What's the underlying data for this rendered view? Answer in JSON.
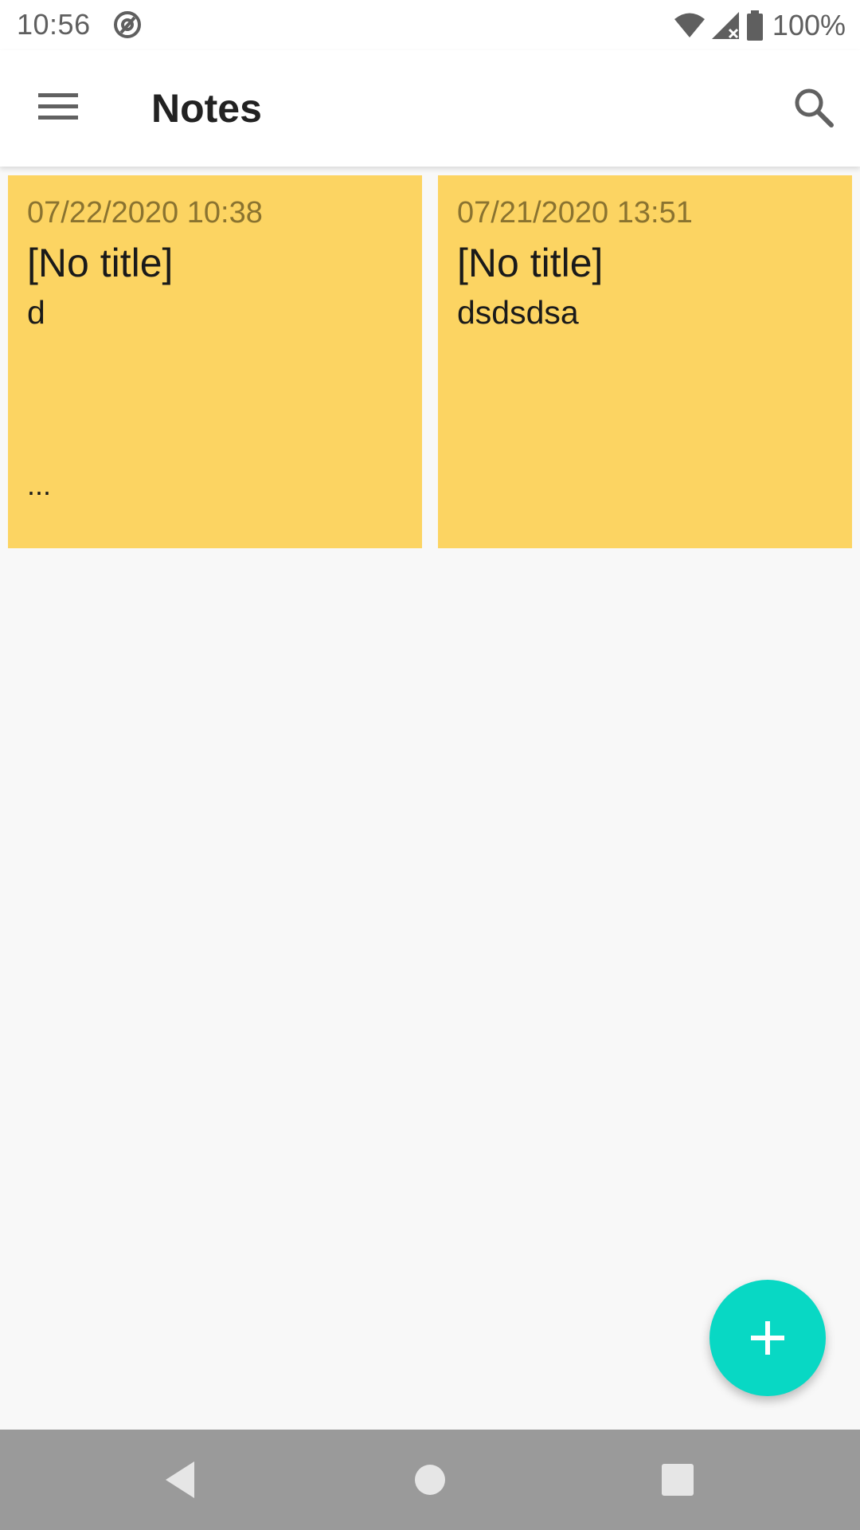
{
  "status_bar": {
    "time": "10:56",
    "battery_percent": "100%"
  },
  "app_bar": {
    "title": "Notes",
    "icons": [
      "menu-icon",
      "search-icon"
    ]
  },
  "notes": [
    {
      "date": "07/22/2020 10:38",
      "title": "[No title]",
      "body": "d",
      "more": "..."
    },
    {
      "date": "07/21/2020 13:51",
      "title": "[No title]",
      "body": "dsdsdsa"
    }
  ],
  "fab": {
    "icon": "plus-icon"
  },
  "nav_bar": {
    "icons": [
      "back-icon",
      "home-icon",
      "recents-icon"
    ]
  },
  "colors": {
    "note_background": "#fcd462",
    "fab": "#08d8c4",
    "nav_bar": "#9a9a9a"
  }
}
